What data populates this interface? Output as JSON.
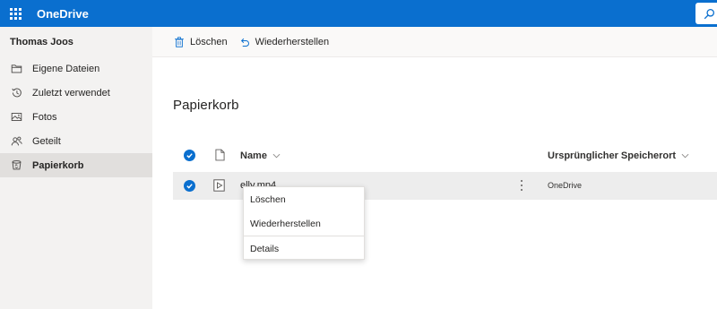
{
  "app": {
    "title": "OneDrive"
  },
  "colors": {
    "accent": "#0a6fcf",
    "sidebar_bg": "#f3f2f1",
    "active_item_bg": "#e1dfdd",
    "selected_row_bg": "#ededed"
  },
  "sidebar": {
    "user_name": "Thomas Joos",
    "items": [
      {
        "label": "Eigene Dateien",
        "icon": "folder-icon",
        "active": false
      },
      {
        "label": "Zuletzt verwendet",
        "icon": "history-icon",
        "active": false
      },
      {
        "label": "Fotos",
        "icon": "photo-icon",
        "active": false
      },
      {
        "label": "Geteilt",
        "icon": "people-icon",
        "active": false
      },
      {
        "label": "Papierkorb",
        "icon": "recycle-bin-icon",
        "active": true
      }
    ]
  },
  "toolbar": {
    "delete_label": "Löschen",
    "restore_label": "Wiederherstellen"
  },
  "main": {
    "title": "Papierkorb",
    "columns": {
      "name": "Name",
      "location": "Ursprünglicher Speicherort"
    },
    "rows": [
      {
        "name": "elly.mp4",
        "location": "OneDrive",
        "selected": true,
        "type_icon": "video-file-icon"
      }
    ]
  },
  "context_menu": {
    "items": [
      "Löschen",
      "Wiederherstellen",
      "Details"
    ]
  }
}
